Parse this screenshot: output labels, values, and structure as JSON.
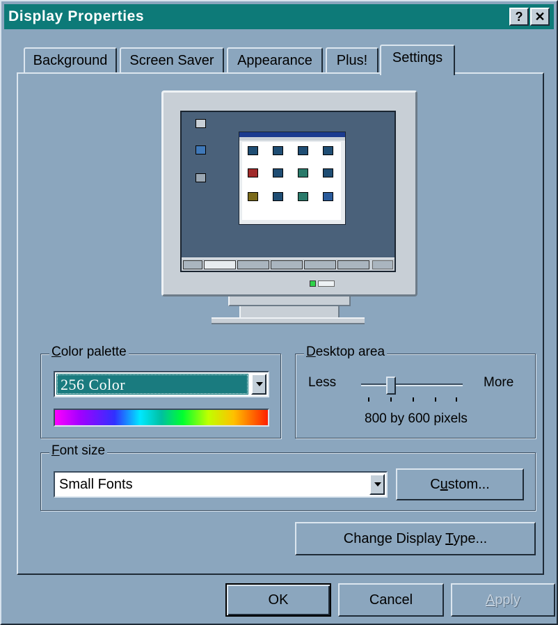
{
  "window": {
    "title": "Display Properties",
    "help_button": "?",
    "close_button": "✕"
  },
  "tabs": [
    {
      "label": "Background",
      "active": false
    },
    {
      "label": "Screen Saver",
      "active": false
    },
    {
      "label": "Appearance",
      "active": false
    },
    {
      "label": "Plus!",
      "active": false
    },
    {
      "label": "Settings",
      "active": true
    }
  ],
  "color_palette": {
    "label_accel": "C",
    "label_rest": "olor palette",
    "selected": "256 Color"
  },
  "desktop_area": {
    "label_accel": "D",
    "label_rest": "esktop area",
    "less_label": "Less",
    "more_label": "More",
    "value_text": "800 by 600 pixels",
    "slider_position": 0.25
  },
  "font_size": {
    "label_accel": "F",
    "label_rest": "ont size",
    "selected": "Small Fonts",
    "custom_before": "C",
    "custom_accel": "u",
    "custom_after": "stom..."
  },
  "change_display": {
    "before": "Change Display ",
    "accel": "T",
    "after": "ype..."
  },
  "buttons": {
    "ok": "OK",
    "cancel": "Cancel",
    "apply_accel": "A",
    "apply_rest": "pply"
  },
  "colors": {
    "title_bar": "#0d7a78",
    "dialog_bg": "#8ba6be",
    "selection": "#1a7b7f",
    "preview_desktop": "#4a617a"
  }
}
